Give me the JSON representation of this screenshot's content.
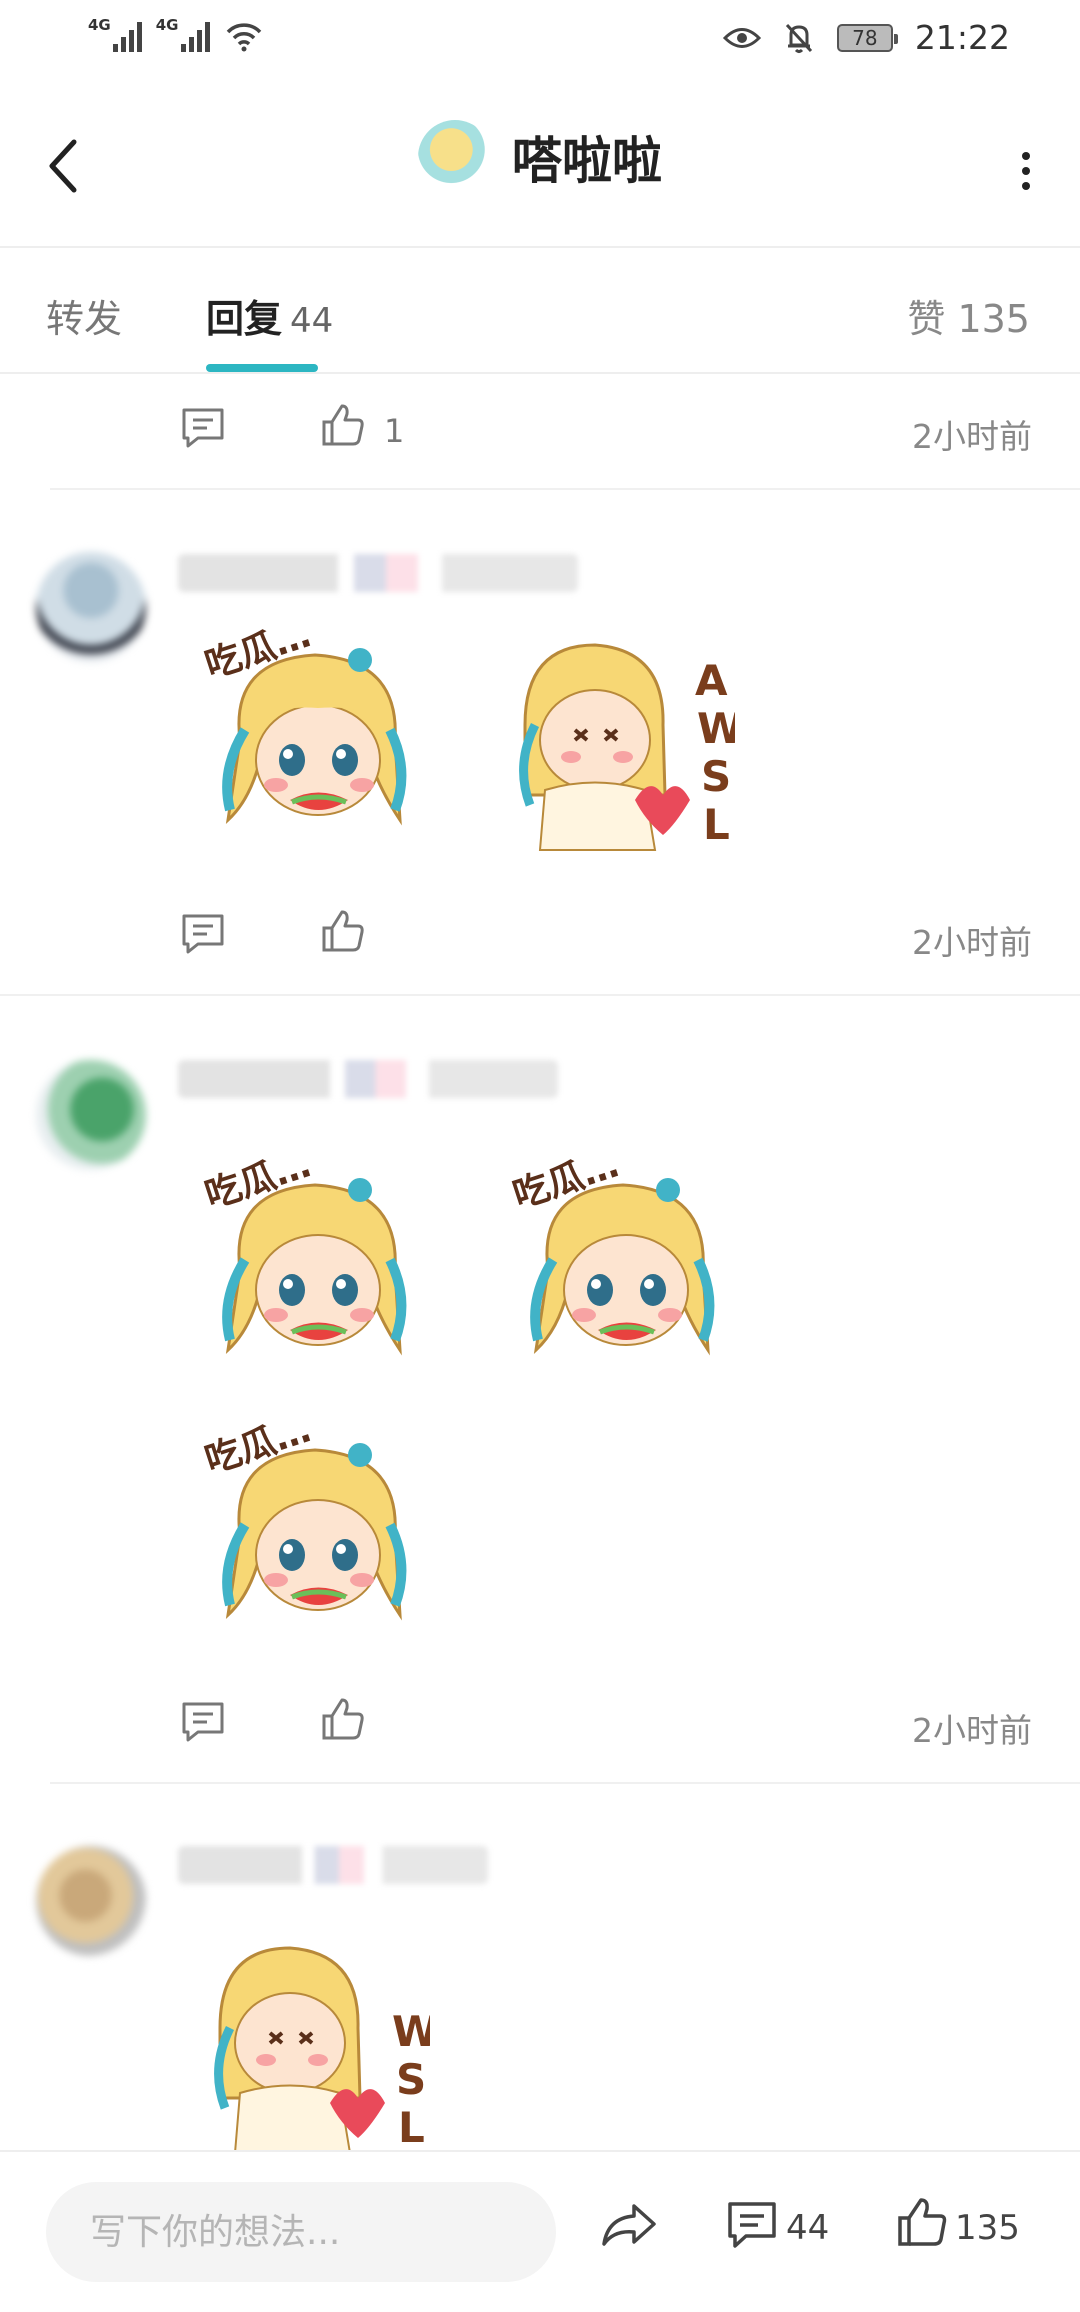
{
  "status_bar": {
    "signal_1": "4G",
    "signal_2": "4G",
    "battery": "78",
    "time": "21:22"
  },
  "header": {
    "title": "嗒啦啦"
  },
  "tabs": {
    "forward_label": "转发",
    "reply_label": "回复",
    "reply_count": "44",
    "like_label": "赞 135"
  },
  "replies": [
    {
      "like_count": "1",
      "time_ago": "2小时前"
    },
    {
      "like_count": "",
      "time_ago": "2小时前",
      "stickers": [
        "吃瓜",
        "AWSL"
      ]
    },
    {
      "like_count": "",
      "time_ago": "2小时前",
      "stickers": [
        "吃瓜",
        "吃瓜",
        "吃瓜"
      ]
    },
    {
      "stickers": [
        "AWSL"
      ]
    }
  ],
  "sticker_text": {
    "eat_melon": "吃瓜…",
    "awsl": "AWSL"
  },
  "bottom_bar": {
    "input_placeholder": "写下你的想法...",
    "comment_count": "44",
    "like_count": "135"
  },
  "colors": {
    "accent": "#2cb6c2",
    "text": "#222222",
    "muted": "#888888"
  }
}
